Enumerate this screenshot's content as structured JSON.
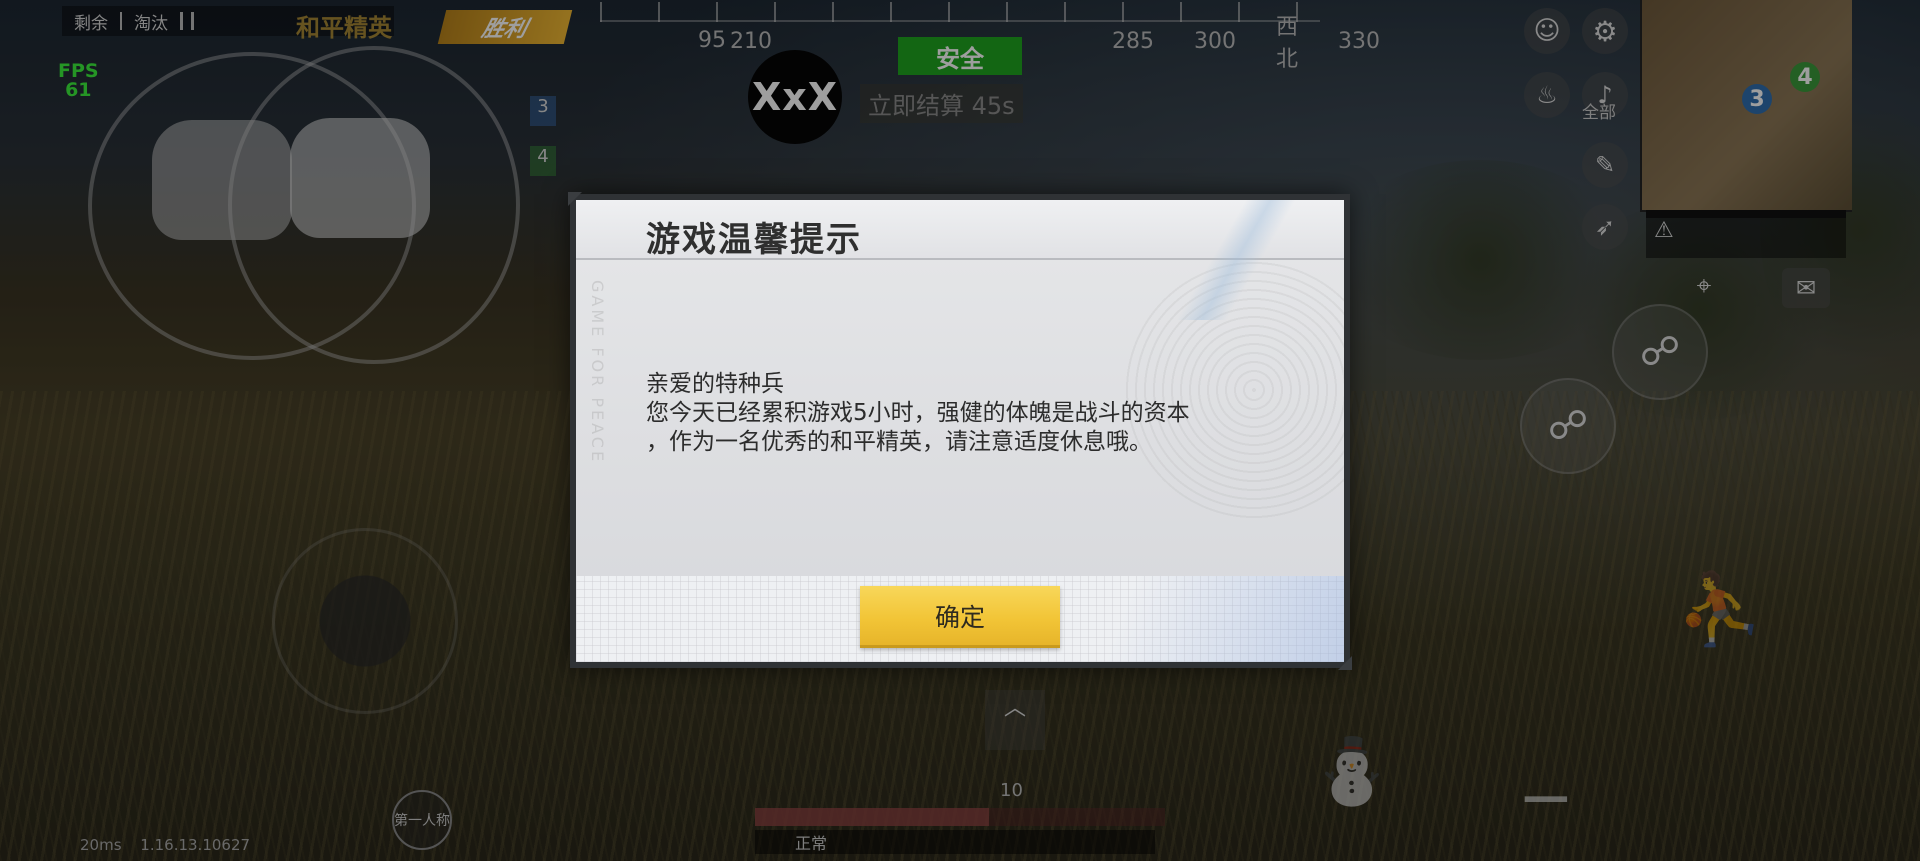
{
  "hud": {
    "remaining_label": "剩余",
    "eliminated_label": "淘汰",
    "game_logo": "和平精英",
    "victory_badge": "胜利",
    "fps_label": "FPS",
    "fps_value": "61",
    "compass": [
      "210",
      "285",
      "300",
      "西北",
      "330"
    ],
    "compass_partial_left": "95",
    "safe_zone": "安全",
    "settle_text": "立即结算 45s",
    "player_tag": "XxX",
    "team_numbers": [
      "3",
      "4"
    ],
    "voice_all_label": "全部",
    "perspective_label": "第一人称",
    "ammo_count": "10",
    "status_label": "正常",
    "ping_text": "20ms",
    "version_text": "1.16.13.10627",
    "health_fraction": 0.57,
    "minimap_markers": [
      "3",
      "4"
    ]
  },
  "dialog": {
    "title": "游戏温馨提示",
    "side_text": "GAME FOR PEACE",
    "greeting": "亲爱的特种兵",
    "message_line1": "您今天已经累积游戏5小时，强健的体魄是战斗的资本",
    "message_line2": "，作为一名优秀的和平精英，请注意适度休息哦。",
    "confirm_label": "确定"
  },
  "colors": {
    "safe_green": "#1fa51f",
    "fps_green": "#3cf13c",
    "confirm_yellow": "#f2c537",
    "victory_gold": "#f0b833"
  }
}
